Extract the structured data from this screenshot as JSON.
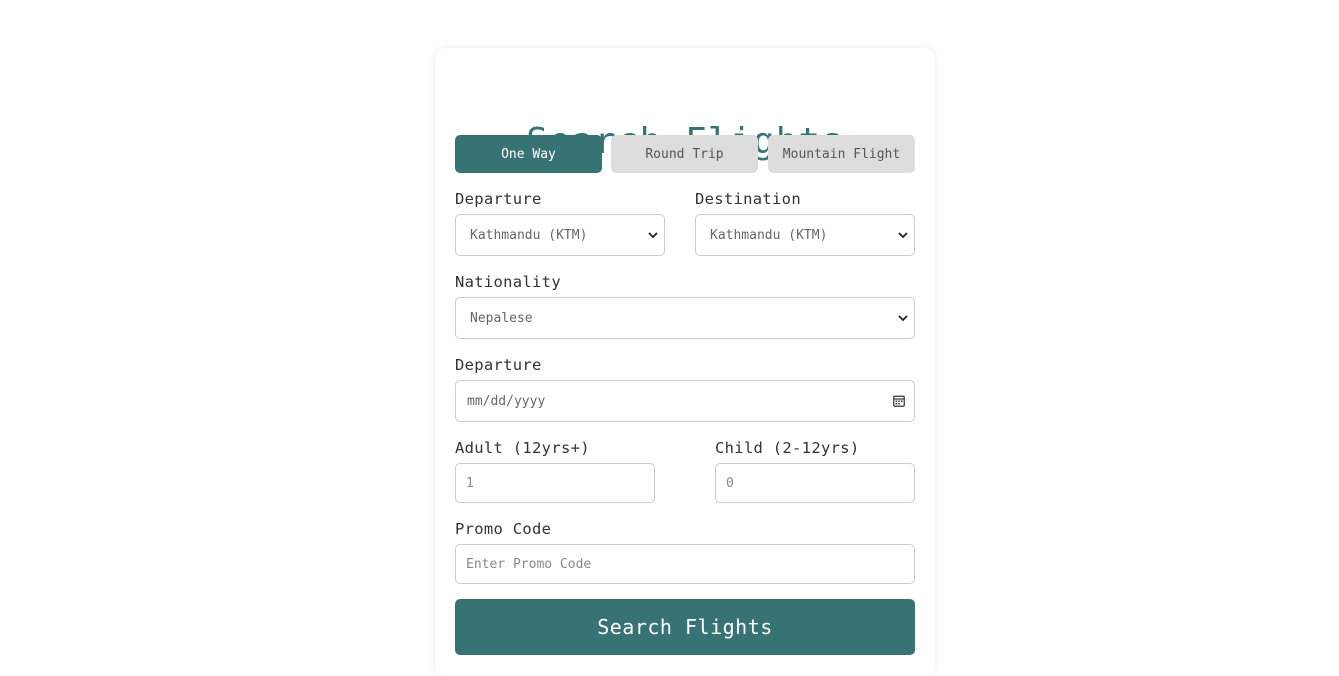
{
  "form": {
    "title": "Search Flights",
    "trip_types": [
      {
        "label": "One Way",
        "active": true
      },
      {
        "label": "Round Trip",
        "active": false
      },
      {
        "label": "Mountain Flight",
        "active": false
      }
    ],
    "departure": {
      "label": "Departure",
      "value": "Kathmandu (KTM)"
    },
    "destination": {
      "label": "Destination",
      "value": "Kathmandu (KTM)"
    },
    "nationality": {
      "label": "Nationality",
      "value": "Nepalese"
    },
    "departure_date": {
      "label": "Departure",
      "placeholder": "mm/dd/yyyy"
    },
    "adult": {
      "label": "Adult (12yrs+)",
      "value": "1"
    },
    "child": {
      "label": "Child (2-12yrs)",
      "value": "0"
    },
    "promo": {
      "label": "Promo Code",
      "placeholder": "Enter Promo Code"
    },
    "submit_label": "Search Flights"
  },
  "colors": {
    "accent": "#377275",
    "inactive_button": "#dddddd",
    "border": "#cccccc"
  },
  "icons": {
    "select": "chevron-down-icon",
    "date": "calendar-icon"
  }
}
